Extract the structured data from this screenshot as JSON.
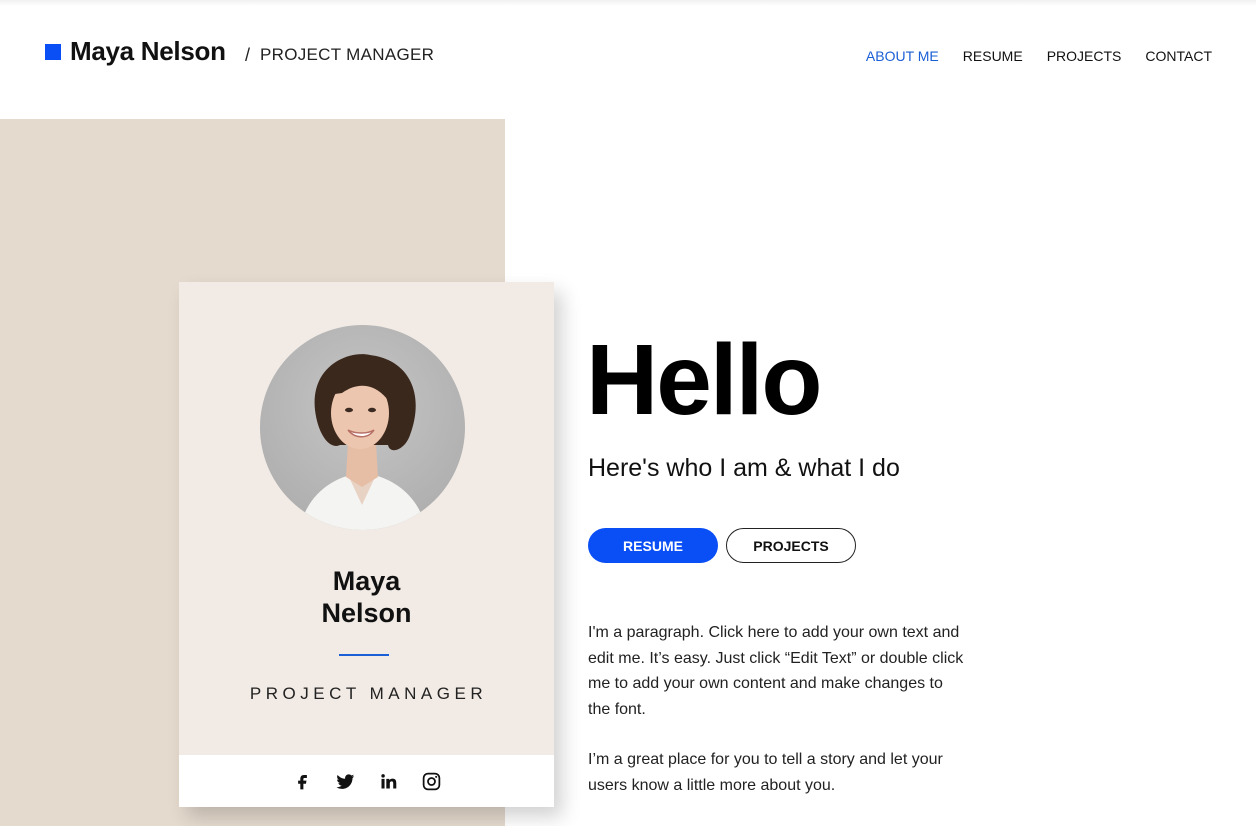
{
  "header": {
    "brand_name": "Maya Nelson",
    "separator": "/",
    "brand_role": "PROJECT MANAGER",
    "nav": [
      {
        "label": "ABOUT ME",
        "active": true
      },
      {
        "label": "RESUME",
        "active": false
      },
      {
        "label": "PROJECTS",
        "active": false
      },
      {
        "label": "CONTACT",
        "active": false
      }
    ]
  },
  "card": {
    "first_name": "Maya",
    "last_name": "Nelson",
    "role": "PROJECT MANAGER",
    "social": [
      "facebook-icon",
      "twitter-icon",
      "linkedin-icon",
      "instagram-icon"
    ]
  },
  "hero": {
    "heading": "Hello",
    "subtitle": "Here's who I am & what I do",
    "primary_button": "RESUME",
    "secondary_button": "PROJECTS",
    "paragraph_1": "I'm a paragraph. Click here to add your own text and edit me. It’s easy. Just click “Edit Text” or double click me to add your own content and make changes to the font.",
    "paragraph_2": "I’m a great place for you to tell a story and let your users know a little more about you."
  },
  "colors": {
    "accent": "#0a4ef5",
    "nav_active": "#1a5fd6",
    "beige_block": "#e5dace",
    "card_bg": "#f2ebe5"
  }
}
